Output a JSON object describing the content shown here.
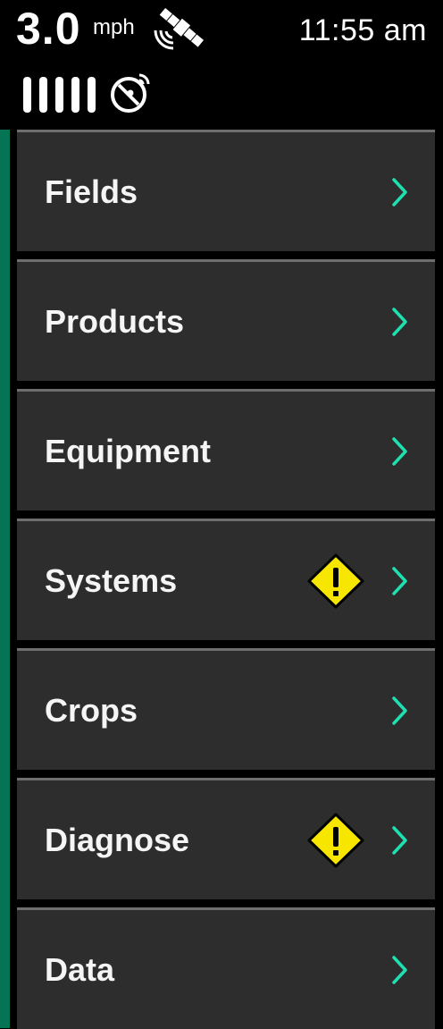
{
  "status": {
    "speed_value": "3.0",
    "speed_unit": "mph",
    "time": "11:55 am",
    "satellite_icon": "satellite-icon",
    "signal_icon": "signal-bars-icon",
    "dish_icon": "satellite-dish-icon"
  },
  "colors": {
    "accent_green": "#047454",
    "chevron": "#1ee0b0",
    "warning": "#f7e600",
    "item_bg": "#2d2d2d"
  },
  "menu": {
    "items": [
      {
        "label": "Fields",
        "warning": false
      },
      {
        "label": "Products",
        "warning": false
      },
      {
        "label": "Equipment",
        "warning": false
      },
      {
        "label": "Systems",
        "warning": true
      },
      {
        "label": "Crops",
        "warning": false
      },
      {
        "label": "Diagnose",
        "warning": true
      },
      {
        "label": "Data",
        "warning": false
      }
    ]
  }
}
